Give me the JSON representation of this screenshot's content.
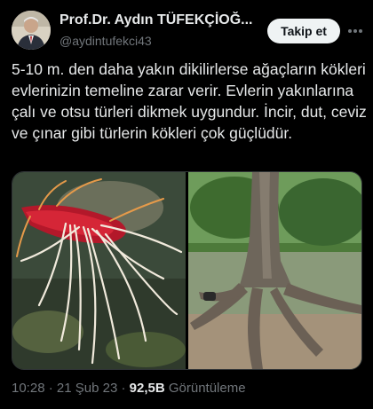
{
  "author": {
    "name": "Prof.Dr. Aydın TÜFEKÇİOĞ...",
    "handle": "@aydintufekci43"
  },
  "follow_label": "Takip et",
  "more_icon": "more-dots-icon",
  "tweet_text": "5-10 m. den daha yakın dikilirlerse ağaçların kökleri evlerinizin temeline zarar verir. Evlerin yakınlarına çalı ve otsu türleri dikmek uygundur. İncir, dut, ceviz ve çınar gibi türlerin kökleri çok güçlüdür.",
  "meta": {
    "time": "10:28",
    "separator": "·",
    "date": "21 Şub 23",
    "views_count": "92,5B",
    "views_label": "Görüntüleme"
  }
}
